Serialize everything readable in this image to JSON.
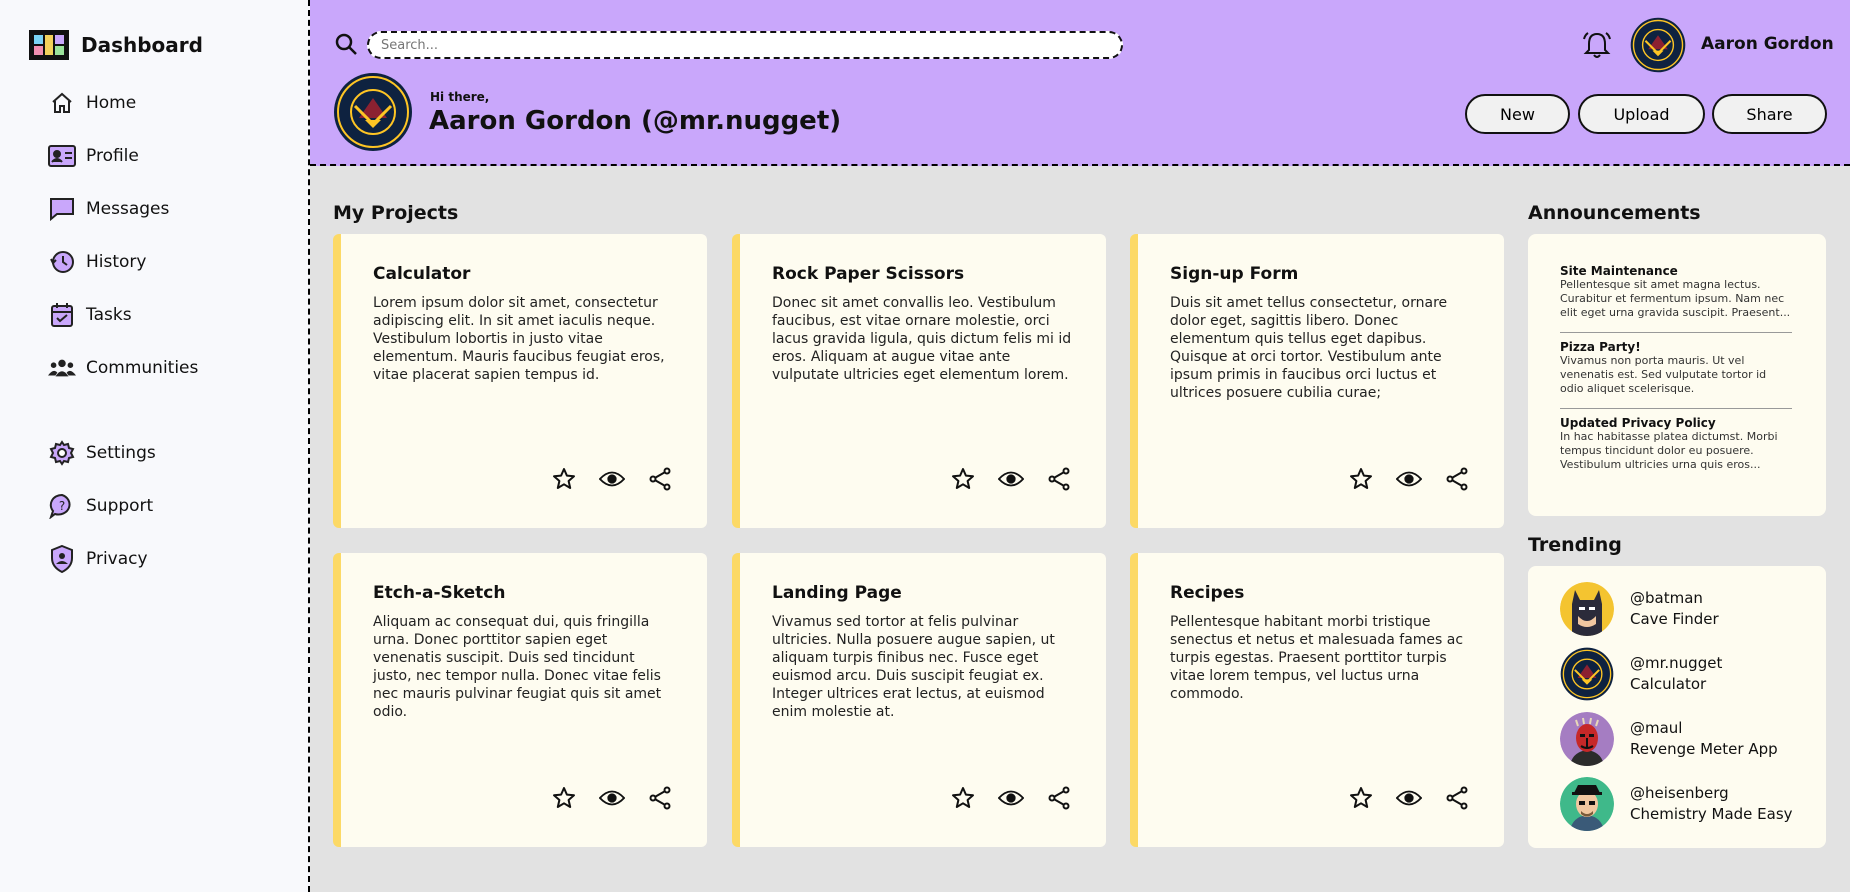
{
  "sidebar": {
    "brand": "Dashboard",
    "items": [
      {
        "label": "Home"
      },
      {
        "label": "Profile"
      },
      {
        "label": "Messages"
      },
      {
        "label": "History"
      },
      {
        "label": "Tasks"
      },
      {
        "label": "Communities"
      },
      {
        "label": "Settings"
      },
      {
        "label": "Support"
      },
      {
        "label": "Privacy"
      }
    ]
  },
  "header": {
    "search_placeholder": "Search...",
    "user_name": "Aaron Gordon",
    "greeting": "Hi there,",
    "headline": "Aaron Gordon (@mr.nugget)",
    "buttons": {
      "new": "New",
      "upload": "Upload",
      "share": "Share"
    }
  },
  "projects": {
    "title": "My Projects",
    "cards": [
      {
        "title": "Calculator",
        "text": "Lorem ipsum dolor sit amet, consectetur adipiscing elit. In sit amet iaculis neque. Vestibulum lobortis in justo vitae elementum. Mauris faucibus feugiat eros, vitae placerat sapien tempus id."
      },
      {
        "title": "Rock Paper Scissors",
        "text": "Donec sit amet convallis leo. Vestibulum faucibus, est vitae ornare molestie, orci lacus gravida ligula, quis dictum felis mi id eros. Aliquam at augue vitae ante vulputate ultricies eget elementum lorem."
      },
      {
        "title": "Sign-up Form",
        "text": "Duis sit amet tellus consectetur, ornare dolor eget, sagittis libero. Donec elementum quis tellus eget dapibus. Quisque at orci tortor. Vestibulum ante ipsum primis in faucibus orci luctus et ultrices posuere cubilia curae;"
      },
      {
        "title": "Etch-a-Sketch",
        "text": "Aliquam ac consequat dui, quis fringilla urna. Donec porttitor sapien eget venenatis suscipit. Duis sed tincidunt justo, nec tempor nulla. Donec vitae felis nec mauris pulvinar feugiat quis sit amet odio."
      },
      {
        "title": "Landing Page",
        "text": "Vivamus sed tortor at felis pulvinar ultricies. Nulla posuere augue sapien, ut aliquam turpis finibus nec. Fusce eget euismod arcu. Duis suscipit feugiat ex. Integer ultrices erat lectus, at euismod enim molestie at."
      },
      {
        "title": "Recipes",
        "text": "Pellentesque habitant morbi tristique senectus et netus et malesuada fames ac turpis egestas. Praesent porttitor turpis vitae lorem tempus, vel luctus urna commodo."
      }
    ]
  },
  "announcements": {
    "title": "Announcements",
    "items": [
      {
        "title": "Site Maintenance",
        "text": "Pellentesque sit amet magna lectus. Curabitur et fermentum ipsum. Nam nec elit eget urna gravida suscipit. Praesent..."
      },
      {
        "title": "Pizza Party!",
        "text": "Vivamus non porta mauris. Ut vel venenatis est. Sed vulputate tortor id odio aliquet scelerisque."
      },
      {
        "title": "Updated Privacy Policy",
        "text": "In hac habitasse platea dictumst. Morbi tempus tincidunt dolor eu posuere. Vestibulum ultricies urna quis eros..."
      }
    ]
  },
  "trending": {
    "title": "Trending",
    "items": [
      {
        "handle": "@batman",
        "project": "Cave Finder"
      },
      {
        "handle": "@mr.nugget",
        "project": "Calculator"
      },
      {
        "handle": "@maul",
        "project": "Revenge Meter App"
      },
      {
        "handle": "@heisenberg",
        "project": "Chemistry Made Easy"
      }
    ]
  },
  "colors": {
    "header_bg": "#c9a7fb",
    "card_accent": "#fcd966",
    "card_bg": "#fefcf0",
    "page_bg": "#e2e2e2"
  }
}
